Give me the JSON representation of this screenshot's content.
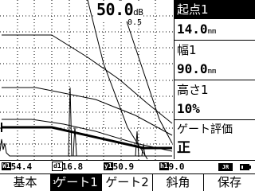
{
  "gain": {
    "value": "50.0",
    "unit": "dB",
    "step": "0.5"
  },
  "panel": {
    "start_label": "起点1",
    "start_value": "14.0",
    "start_unit": "mm",
    "width_label": "幅1",
    "width_value": "90.0",
    "width_unit": "mm",
    "height_label": "高さ1",
    "height_value": "10%",
    "eval_label": "ゲート評価",
    "eval_result": "正"
  },
  "status_bar": {
    "measurements": [
      {
        "tag": "W1",
        "value": "54.4",
        "selected": false
      },
      {
        "tag": "d1",
        "value": "16.8",
        "selected": true
      },
      {
        "tag": "y1",
        "value": "50.9",
        "selected": false
      },
      {
        "tag": "h1",
        "value": "9.0",
        "selected": false
      }
    ],
    "mode": "JR",
    "icon": "battery-icon"
  },
  "function_keys": [
    {
      "label": "基本",
      "selected": false
    },
    {
      "label": "ゲート1",
      "selected": true,
      "index": "1"
    },
    {
      "label": "ゲート2",
      "selected": false
    },
    {
      "label": "斜角",
      "selected": false
    },
    {
      "label": "保存",
      "selected": false
    }
  ],
  "waveform": {
    "gate_level_percent": 10,
    "gate_start_mm": 14.0,
    "gate_width_mm": 90.0
  }
}
